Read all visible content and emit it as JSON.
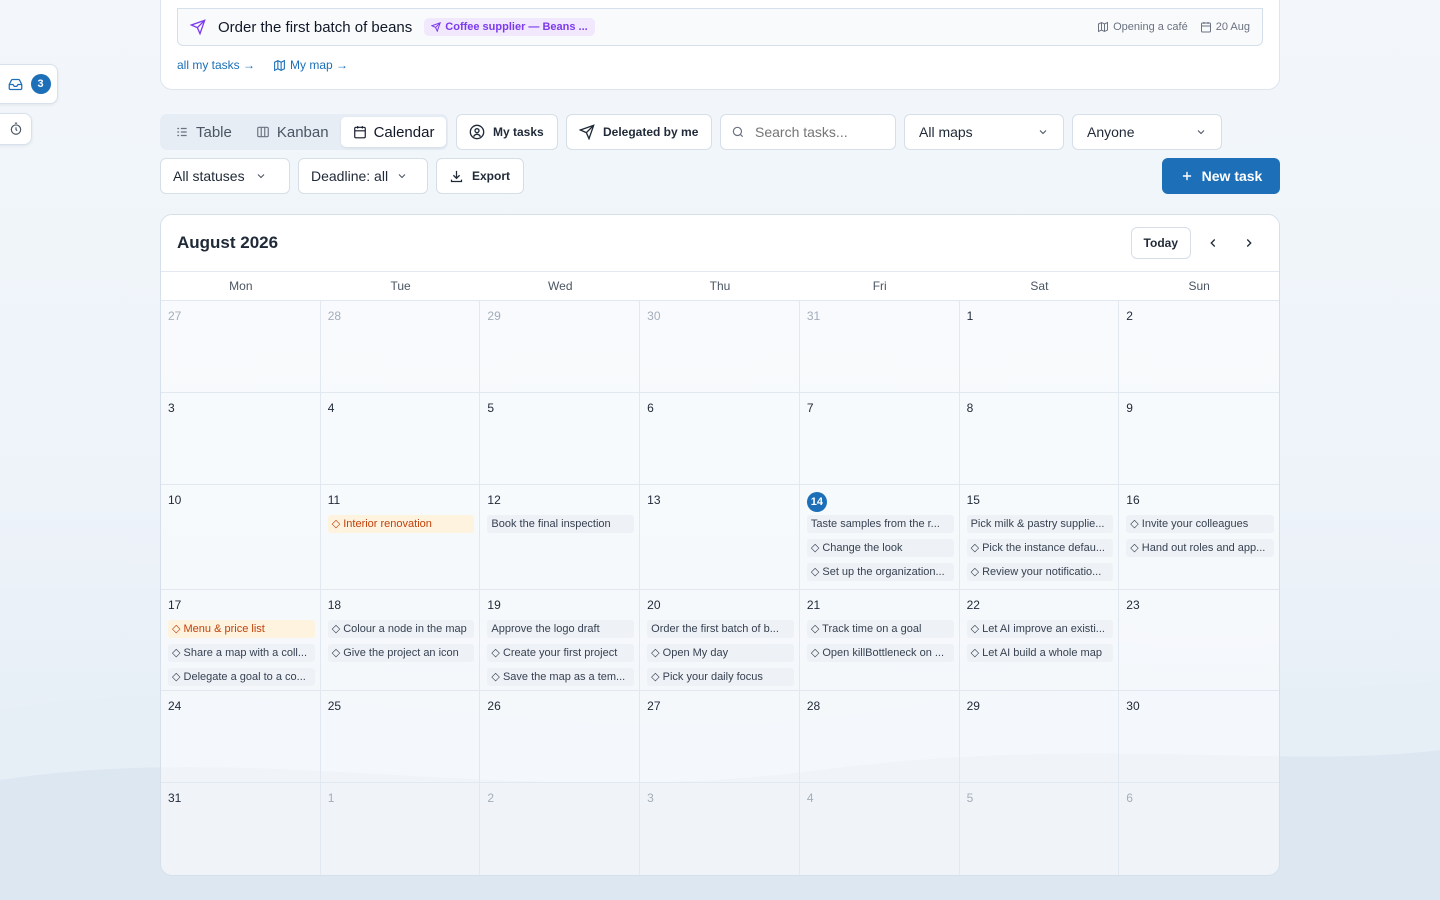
{
  "dock": {
    "inbox_count": "3"
  },
  "top_task": {
    "title": "Order the first batch of beans",
    "tag": "Coffee supplier — Beans ...",
    "map": "Opening a café",
    "date": "20 Aug"
  },
  "links": {
    "all_tasks": "all my tasks →",
    "my_map": "My map →"
  },
  "views": {
    "table": "Table",
    "kanban": "Kanban",
    "calendar": "Calendar"
  },
  "filters": {
    "my_tasks": "My tasks",
    "delegated": "Delegated by me",
    "search_placeholder": "Search tasks...",
    "maps": "All maps",
    "assignee": "Anyone",
    "statuses": "All statuses",
    "deadline": "Deadline: all",
    "export": "Export",
    "new_task": "New task"
  },
  "calendar": {
    "title": "August 2026",
    "today": "Today",
    "weekdays": [
      "Mon",
      "Tue",
      "Wed",
      "Thu",
      "Fri",
      "Sat",
      "Sun"
    ],
    "weeks": [
      {
        "days": [
          {
            "n": "27",
            "muted": true,
            "tasks": []
          },
          {
            "n": "28",
            "muted": true,
            "tasks": []
          },
          {
            "n": "29",
            "muted": true,
            "tasks": []
          },
          {
            "n": "30",
            "muted": true,
            "tasks": []
          },
          {
            "n": "31",
            "muted": true,
            "tasks": []
          },
          {
            "n": "1",
            "tasks": []
          },
          {
            "n": "2",
            "tasks": []
          }
        ]
      },
      {
        "days": [
          {
            "n": "3",
            "tasks": []
          },
          {
            "n": "4",
            "tasks": []
          },
          {
            "n": "5",
            "tasks": []
          },
          {
            "n": "6",
            "tasks": []
          },
          {
            "n": "7",
            "tasks": []
          },
          {
            "n": "8",
            "tasks": []
          },
          {
            "n": "9",
            "tasks": []
          }
        ]
      },
      {
        "days": [
          {
            "n": "10",
            "tasks": []
          },
          {
            "n": "11",
            "tasks": [
              {
                "t": "◇ Interior renovation",
                "warn": true
              }
            ]
          },
          {
            "n": "12",
            "tasks": [
              {
                "t": "Book the final inspection"
              }
            ]
          },
          {
            "n": "13",
            "tasks": []
          },
          {
            "n": "14",
            "today": true,
            "tasks": [
              {
                "t": "Taste samples from the r..."
              },
              {
                "t": "◇ Change the look"
              },
              {
                "t": "◇ Set up the organization..."
              }
            ]
          },
          {
            "n": "15",
            "tasks": [
              {
                "t": "Pick milk & pastry supplie..."
              },
              {
                "t": "◇ Pick the instance defau..."
              },
              {
                "t": "◇ Review your notificatio..."
              }
            ]
          },
          {
            "n": "16",
            "tasks": [
              {
                "t": "◇ Invite your colleagues"
              },
              {
                "t": "◇ Hand out roles and app..."
              }
            ]
          }
        ]
      },
      {
        "days": [
          {
            "n": "17",
            "tasks": [
              {
                "t": "◇ Menu & price list",
                "warn": true
              },
              {
                "t": "◇ Share a map with a coll..."
              },
              {
                "t": "◇ Delegate a goal to a co..."
              }
            ]
          },
          {
            "n": "18",
            "tasks": [
              {
                "t": "◇ Colour a node in the map"
              },
              {
                "t": "◇ Give the project an icon"
              }
            ]
          },
          {
            "n": "19",
            "tasks": [
              {
                "t": "Approve the logo draft"
              },
              {
                "t": "◇ Create your first project"
              },
              {
                "t": "◇ Save the map as a tem..."
              }
            ]
          },
          {
            "n": "20",
            "tasks": [
              {
                "t": "Order the first batch of b..."
              },
              {
                "t": "◇ Open My day"
              },
              {
                "t": "◇ Pick your daily focus"
              }
            ]
          },
          {
            "n": "21",
            "tasks": [
              {
                "t": "◇ Track time on a goal"
              },
              {
                "t": "◇ Open killBottleneck on ..."
              }
            ]
          },
          {
            "n": "22",
            "tasks": [
              {
                "t": "◇ Let AI improve an existi..."
              },
              {
                "t": "◇ Let AI build a whole map"
              }
            ]
          },
          {
            "n": "23",
            "tasks": []
          }
        ]
      },
      {
        "days": [
          {
            "n": "24",
            "tasks": []
          },
          {
            "n": "25",
            "tasks": []
          },
          {
            "n": "26",
            "tasks": []
          },
          {
            "n": "27",
            "tasks": []
          },
          {
            "n": "28",
            "tasks": []
          },
          {
            "n": "29",
            "tasks": []
          },
          {
            "n": "30",
            "tasks": []
          }
        ]
      },
      {
        "days": [
          {
            "n": "31",
            "tasks": []
          },
          {
            "n": "1",
            "muted": true,
            "tasks": []
          },
          {
            "n": "2",
            "muted": true,
            "tasks": []
          },
          {
            "n": "3",
            "muted": true,
            "tasks": []
          },
          {
            "n": "4",
            "muted": true,
            "tasks": []
          },
          {
            "n": "5",
            "muted": true,
            "tasks": []
          },
          {
            "n": "6",
            "muted": true,
            "tasks": []
          }
        ]
      }
    ]
  }
}
